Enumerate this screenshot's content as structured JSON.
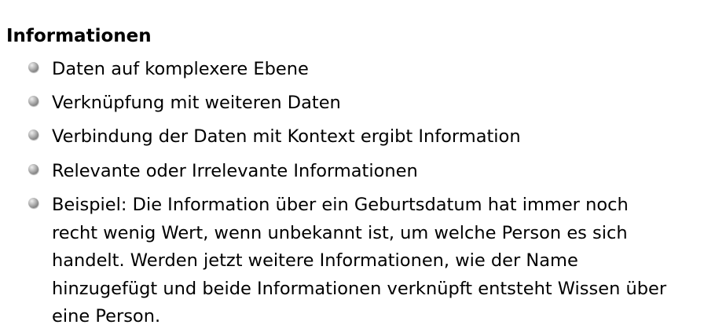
{
  "slide": {
    "heading": "Informationen",
    "items": [
      {
        "text": "Daten auf komplexere Ebene"
      },
      {
        "text": "Verknüpfung mit weiteren Daten"
      },
      {
        "text": "Verbindung der Daten mit Kontext ergibt Information"
      },
      {
        "text": "Relevante oder Irrelevante Informationen"
      },
      {
        "text": "Beispiel: Die Information über ein Geburtsdatum hat immer noch\nrecht wenig Wert, wenn unbekannt ist, um welche Person es sich\nhandelt. Werden jetzt weitere Informationen, wie der Name\nhinzugefügt und beide Informationen verknüpft entsteht Wissen über\neine Person."
      }
    ],
    "bullet_icon": "sphere-bullet-icon",
    "bullet_color": "#8c8c8c"
  }
}
